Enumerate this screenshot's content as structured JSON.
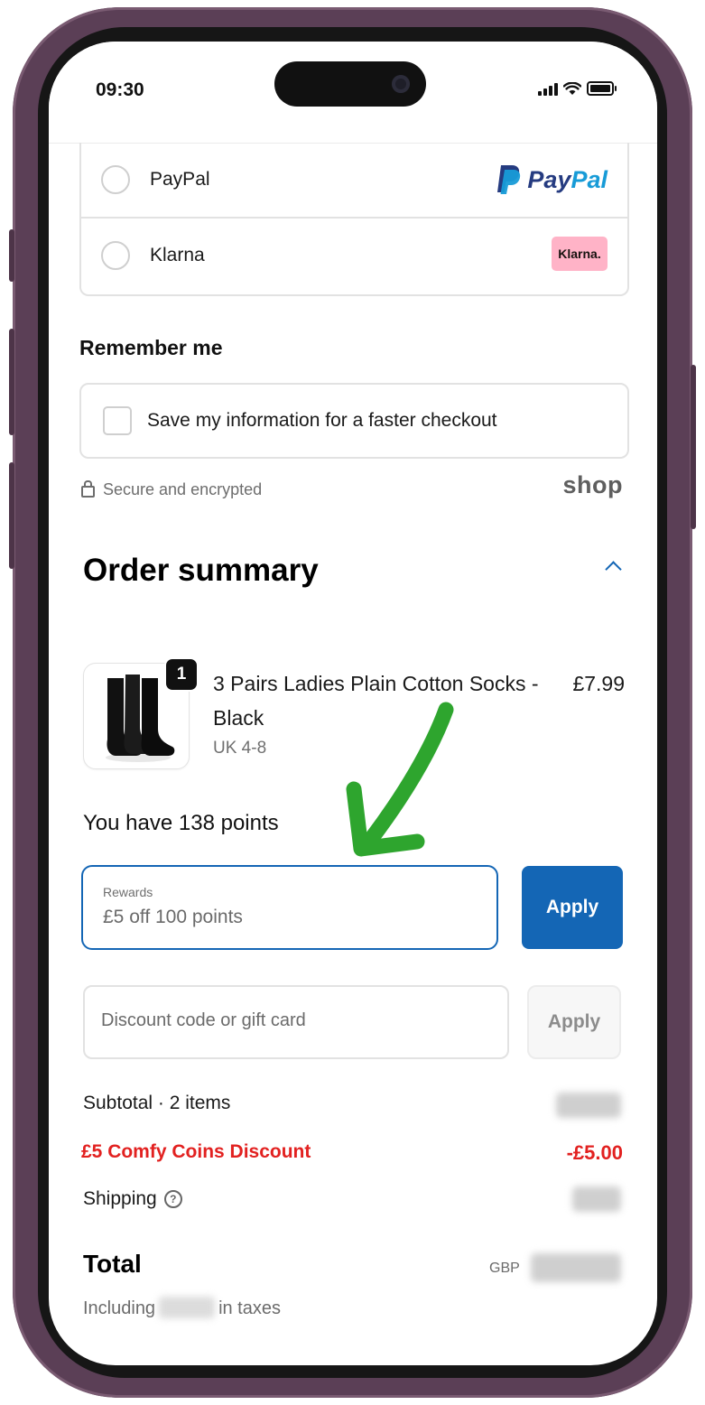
{
  "status_bar": {
    "time": "09:30"
  },
  "payment_methods": [
    {
      "label": "PayPal",
      "logo_text": [
        "Pay",
        "Pal"
      ]
    },
    {
      "label": "Klarna",
      "logo_text": "Klarna."
    }
  ],
  "remember": {
    "title": "Remember me",
    "checkbox_label": "Save my information for a faster checkout",
    "secure_text": "Secure and encrypted",
    "provider_logo": "shop"
  },
  "order_summary": {
    "title": "Order summary",
    "item": {
      "quantity": "1",
      "name": "3 Pairs Ladies Plain Cotton Socks - Black",
      "variant": "UK 4-8",
      "price": "£7.99"
    },
    "points_text": "You have 138 points",
    "rewards": {
      "label": "Rewards",
      "value": "£5 off 100 points",
      "apply_label": "Apply"
    },
    "discount": {
      "placeholder": "Discount code or gift card",
      "apply_label": "Apply"
    },
    "subtotal_label": "Subtotal · 2 items",
    "discount_label": "£5 Comfy Coins Discount",
    "discount_amount": "-£5.00",
    "shipping_label": "Shipping",
    "total_label": "Total",
    "currency": "GBP",
    "taxes_prefix": "Including",
    "taxes_suffix": "in taxes"
  },
  "colors": {
    "accent": "#1466b5",
    "discount_red": "#e22120",
    "annotation_green": "#2ea52e",
    "phone_frame": "#5b3f56"
  }
}
